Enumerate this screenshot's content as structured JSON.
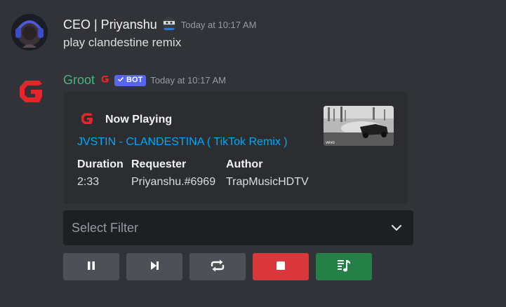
{
  "messages": [
    {
      "username": "CEO | Priyanshu",
      "timestamp": "Today at 10:17 AM",
      "content": "play clandestine remix",
      "avatar_icon": "user-avatar-icon",
      "name_emoji_icon": "ninja-emoji-icon"
    },
    {
      "username": "Groot",
      "username_color": "#43b581",
      "bot_tag": "BOT",
      "timestamp": "Today at 10:17 AM",
      "avatar_icon": "groot-logo-icon",
      "embed": {
        "title": "Now Playing",
        "song": "JVSTIN - CLANDESTINA ( TikTok Remix )",
        "thumbnail_watermark": "vevo",
        "fields": [
          {
            "name": "Duration",
            "value": "2:33"
          },
          {
            "name": "Requester",
            "value": "Priyanshu.#6969"
          },
          {
            "name": "Author",
            "value": "TrapMusicHDTV"
          }
        ]
      },
      "select": {
        "placeholder": "Select Filter"
      },
      "buttons": [
        {
          "icon": "pause-icon",
          "style": "grey"
        },
        {
          "icon": "skip-icon",
          "style": "grey"
        },
        {
          "icon": "loop-icon",
          "style": "grey"
        },
        {
          "icon": "stop-icon",
          "style": "red"
        },
        {
          "icon": "queue-icon",
          "style": "green"
        }
      ]
    }
  ],
  "colors": {
    "background": "#313338",
    "embed_bg": "#2b2d31",
    "link": "#00a8fc",
    "bot_tag": "#5865f2",
    "button_grey": "#4e5058",
    "button_red": "#da373c",
    "button_green": "#248046"
  }
}
